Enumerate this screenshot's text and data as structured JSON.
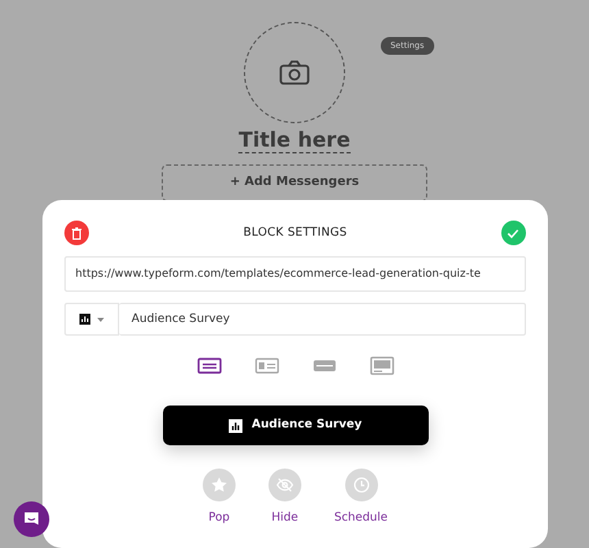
{
  "header": {
    "settings_badge": "Settings",
    "title": "Title here",
    "add_button": "+ Add Messengers"
  },
  "block_settings": {
    "title": "BLOCK SETTINGS",
    "url": "https://www.typeform.com/templates/ecommerce-lead-generation-quiz-te",
    "name": "Audience Survey",
    "styles": [
      {
        "kind": "lines",
        "selected": true
      },
      {
        "kind": "card",
        "selected": false
      },
      {
        "kind": "bar",
        "selected": false
      },
      {
        "kind": "screen",
        "selected": false
      }
    ],
    "preview_button": "Audience Survey",
    "actions": [
      {
        "kind": "star",
        "label": "Pop"
      },
      {
        "kind": "hide",
        "label": "Hide"
      },
      {
        "kind": "clock",
        "label": "Schedule"
      }
    ]
  }
}
